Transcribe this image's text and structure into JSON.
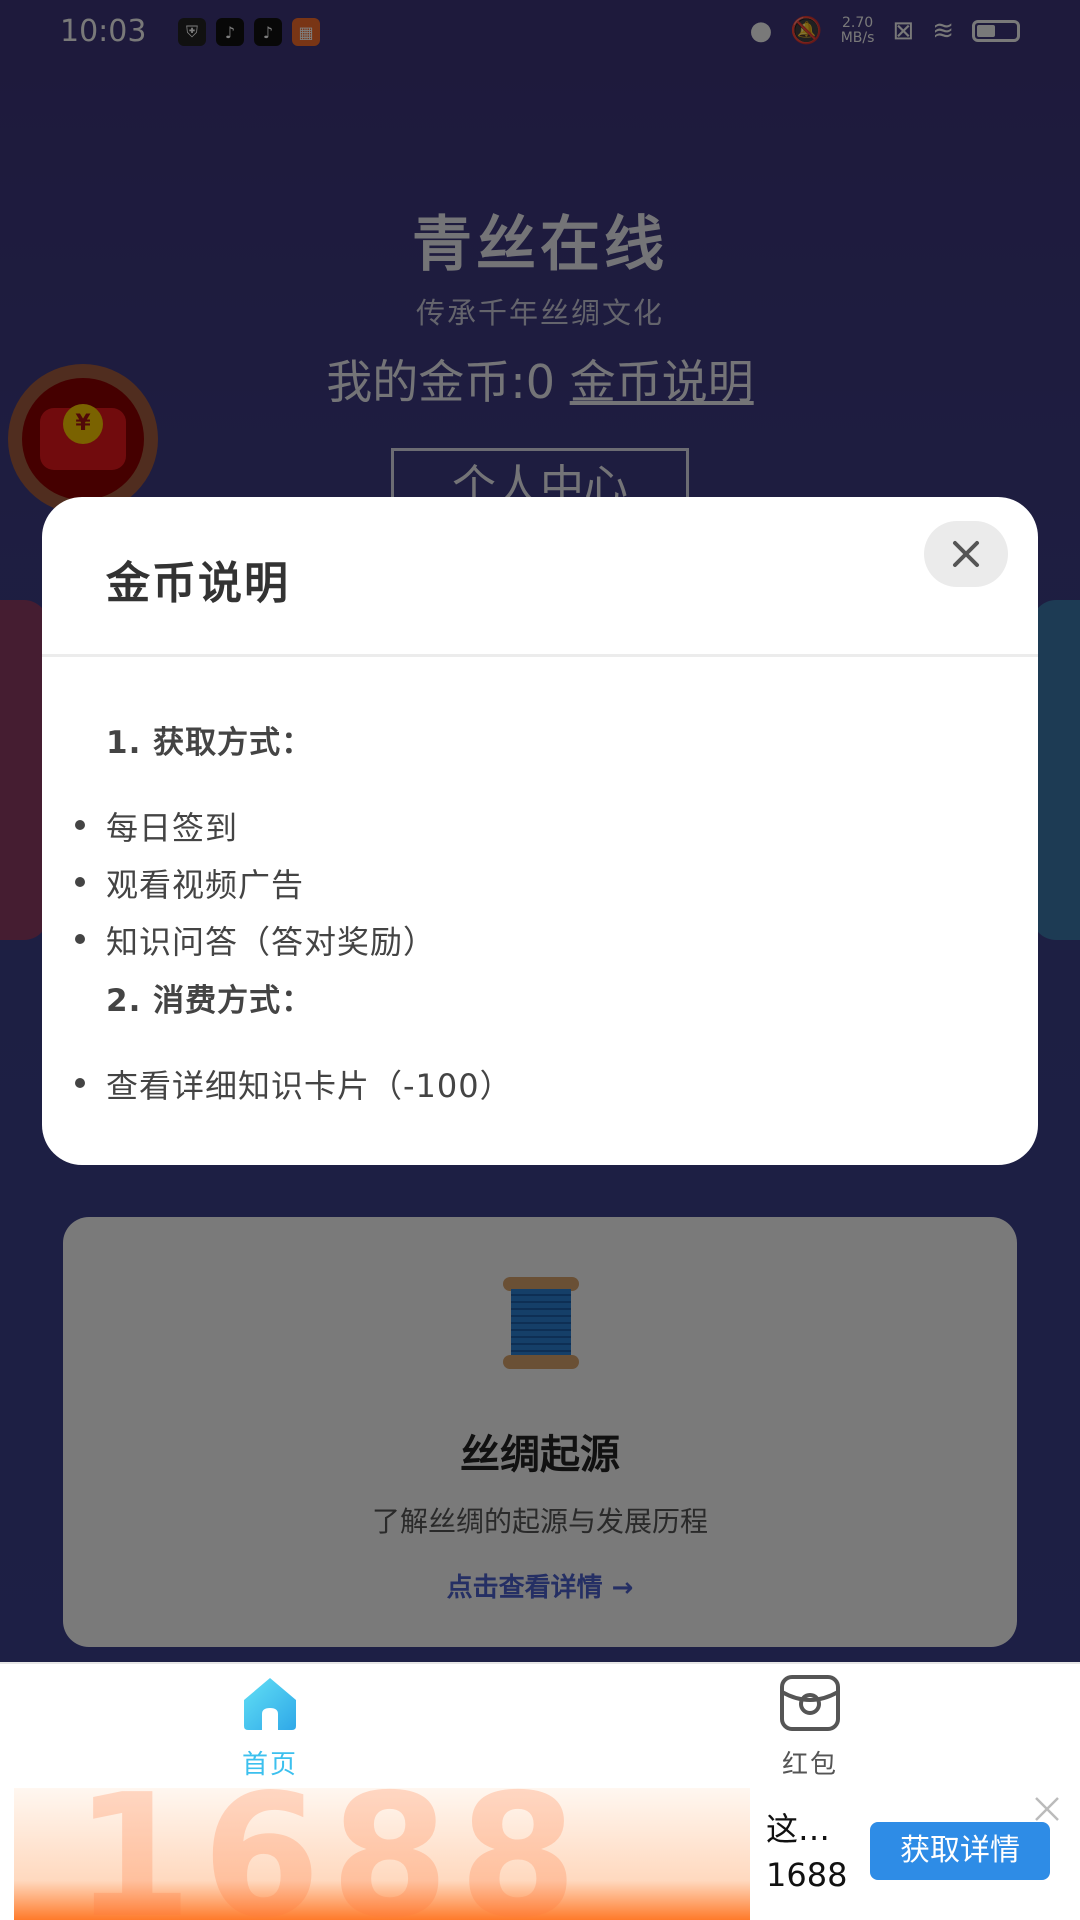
{
  "status_bar": {
    "time": "10:03",
    "net_speed_value": "2.70",
    "net_speed_unit": "MB/s"
  },
  "header": {
    "title": "青丝在线",
    "subtitle": "传承千年丝绸文化",
    "coins_label": "我的金币:0",
    "coins_link": "金币说明",
    "profile_button": "个人中心"
  },
  "feature_card": {
    "icon": "spool-icon",
    "title": "丝绸起源",
    "description": "了解丝绸的起源与发展历程",
    "link": "点击查看详情 →"
  },
  "modal": {
    "title": "金币说明",
    "sections": [
      {
        "heading": "1. 获取方式：",
        "items": [
          "每日签到",
          "观看视频广告",
          "知识问答（答对奖励）"
        ]
      },
      {
        "heading": "2. 消费方式：",
        "items": [
          "查看详细知识卡片（-100）"
        ]
      }
    ]
  },
  "bottom_nav": {
    "items": [
      {
        "label": "首页",
        "icon": "home-icon",
        "active": true
      },
      {
        "label": "红包",
        "icon": "redpacket-icon",
        "active": false
      }
    ],
    "active_color": "#3cc0ee",
    "inactive_color": "#555555"
  },
  "ad": {
    "image_text": "1688",
    "title": "这…",
    "brand": "1688",
    "button": "获取详情"
  },
  "colors": {
    "accent": "#2e8ce6",
    "background": "#3b3e86"
  }
}
